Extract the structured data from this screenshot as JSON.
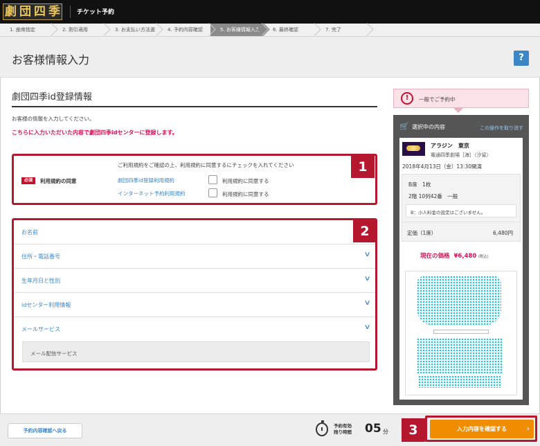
{
  "header": {
    "logo_chars": [
      "劇",
      "団",
      "四",
      "季"
    ],
    "app_title": "チケット予約"
  },
  "steps": [
    {
      "label": "1. 座席指定",
      "active": false
    },
    {
      "label": "2. 割引適用",
      "active": false
    },
    {
      "label": "3. お支払い方法選択",
      "active": false
    },
    {
      "label": "4. 予約内容確認",
      "active": false
    },
    {
      "label": "5. お客様情報入力",
      "active": true
    },
    {
      "label": "6. 最終確認",
      "active": false
    },
    {
      "label": "7. 完了",
      "active": false
    }
  ],
  "page": {
    "title": "お客様情報入力",
    "help": "?"
  },
  "section": {
    "title": "劇団四季id登録情報",
    "intro": "お客様の情報を入力してください。",
    "notice": "こちらに入力いただいた内容で劇団四季idセンターに登録します。"
  },
  "terms": {
    "heading": "ご利用規約をご確認の上、利用規約に同意するにチェックを入れてください",
    "required_badge": "必須",
    "label": "利用規約の同意",
    "items": [
      {
        "link": "劇団四季id登録利用規約",
        "agree": "利用規約に同意する"
      },
      {
        "link": "インターネット予約利用規約",
        "agree": "利用規約に同意する"
      }
    ]
  },
  "badges": {
    "one": "1",
    "two": "2",
    "three": "3"
  },
  "accordion": {
    "items": [
      "お名前",
      "住所・電話番号",
      "生年月日と性別",
      "idセンター利用情報",
      "メールサービス"
    ],
    "chevron": "∨",
    "mail_sub": "メール配信サービス"
  },
  "sidebar": {
    "status": "一般でご予約中",
    "status_icon": "!",
    "cart_title": "選択中の内容",
    "cancel_link": "この操作を取り消す",
    "show_title": "アラジン　東京",
    "venue": "電通四季劇場［海］（汐留）",
    "date": "2018年4月13日（金）13:30開演",
    "seat_class": "B席　1枚",
    "seat_no": "2階 10列42番　一般",
    "seat_note": "B：小人料金の設定はございません。",
    "price_label": "定価（1席）",
    "price_value": "6,480円",
    "current_label": "現在の価格",
    "current_value": "¥6,480",
    "tax": "(税込)"
  },
  "footer": {
    "back": "予約内容確認へ戻る",
    "timer_label_1": "予約有効",
    "timer_label_2": "残り時間",
    "timer_minutes": "05",
    "timer_unit": "分",
    "confirm": "入力内容を確認する",
    "confirm_arrow": "›"
  },
  "colors": {
    "accent_red": "#b5172f",
    "link_blue": "#3d86c6",
    "confirm_orange": "#f08c00",
    "seat_cyan": "#1ec5df"
  }
}
